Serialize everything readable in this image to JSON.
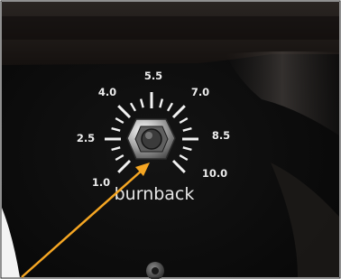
{
  "dial": {
    "name": "burnback",
    "scale": [
      {
        "value": "1.0"
      },
      {
        "value": "2.5"
      },
      {
        "value": "4.0"
      },
      {
        "value": "5.5"
      },
      {
        "value": "7.0"
      },
      {
        "value": "8.5"
      },
      {
        "value": "10.0"
      }
    ]
  },
  "colors": {
    "panel": "#0c0c0c",
    "scale_marks": "#f2f2f2",
    "arrow": "#f5a623",
    "frame_border": "#202020"
  }
}
